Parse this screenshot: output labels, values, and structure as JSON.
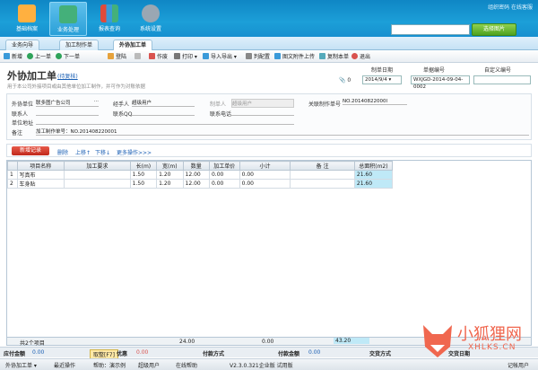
{
  "top": {
    "modules": [
      {
        "label": "基础档案",
        "color": "#ffb040"
      },
      {
        "label": "业务处理",
        "color": "#44b07a"
      },
      {
        "label": "报表查询",
        "color": "#e04a3a"
      },
      {
        "label": "系统设置",
        "color": "#9aa7b3"
      }
    ],
    "links": "组织密码  在线客服",
    "search_placeholder": "",
    "search_button": "选择图片"
  },
  "tabs": [
    "业务向导",
    "加工制作单",
    "外协加工单"
  ],
  "toolbar": [
    "新增",
    "上一单",
    "下一单",
    "登陆",
    "",
    "作废",
    "打印",
    "导入导出",
    "判配置",
    "图文附件上传",
    "复制本单",
    "退出"
  ],
  "form": {
    "title": "外协加工单",
    "title_link": "(待复核)",
    "subtitle": "用于本公司外接项目或由其他单位加工制作，并可作为对账依据",
    "attach_count": "0",
    "hdr_labels": [
      "制单日期",
      "单据编号",
      "自定义编号"
    ],
    "date": "2014/9/4",
    "doc_no": "WXJGD-2014-09-04-0002",
    "custom_no": "",
    "fields": {
      "unit_label": "外协单位",
      "unit_value": "联多图广告公司",
      "handler_label": "经手人",
      "handler_value": "超级用户",
      "maker_label": "制单人",
      "maker_value": "超级用户",
      "related_label": "关联制作单号",
      "related_value": "NO.20140822000l",
      "contact_label": "联系人",
      "qq_label": "联系QQ",
      "phone_label": "联系电话",
      "addr_label": "单位地址",
      "remark_label": "备注",
      "remark_value": "加工制作单号：NO.201408220001"
    }
  },
  "grid_tools": {
    "add": "新增记录",
    "delete": "删除",
    "up": "上移↑",
    "down": "下移↓",
    "more": "更多操作>>>"
  },
  "table": {
    "headers": [
      "",
      "项目名称",
      "加工要求",
      "长(m)",
      "宽(m)",
      "数量",
      "加工单价",
      "小计",
      "备 注",
      "总面积(m2)"
    ],
    "rows": [
      [
        "1",
        "写真布",
        "",
        "1.50",
        "1.20",
        "12.00",
        "0.00",
        "0.00",
        "",
        "21.60"
      ],
      [
        "2",
        "车身贴",
        "",
        "1.50",
        "1.20",
        "12.00",
        "0.00",
        "0.00",
        "",
        "21.60"
      ]
    ],
    "summary": {
      "count": "共2个项目",
      "qty": "24.00",
      "subtotal": "0.00",
      "area": "43.20"
    }
  },
  "bottom1": {
    "total_label": "应付金额",
    "total": "0.00",
    "discount_label": "取整[F7]",
    "discount": "优惠",
    "discount_val": "0.00",
    "pay_method": "付款方式",
    "paid_label": "付款金额",
    "paid": "0.00",
    "settle_label": "交货方式",
    "deliver_label": "交货日期"
  },
  "bottom2": {
    "item1": "外协加工单 ▾",
    "item2": "最近操作",
    "item3": "帮助：演示例",
    "user": "超级用户",
    "help": "在线帮助",
    "version": "V2.3.0.321企业版 试用版",
    "right1": "记帐用户"
  },
  "watermark": {
    "cn": "小狐狸网",
    "en": "XHLKS.CN"
  }
}
